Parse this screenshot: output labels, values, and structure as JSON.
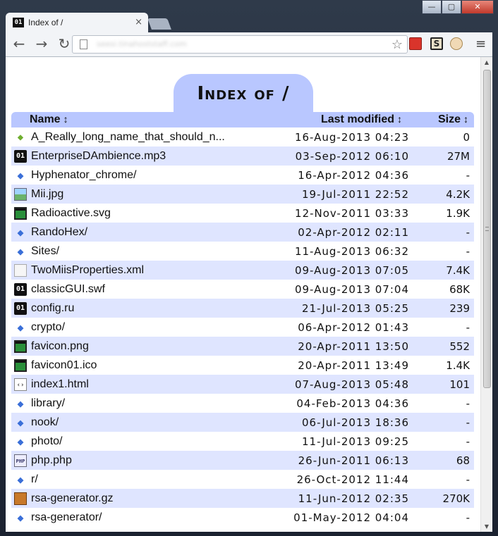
{
  "browser": {
    "tab_title": "Index of /",
    "tab_favicon_text": "01",
    "tab_close": "×",
    "url": "seesi.tinahoststaff.com",
    "window_buttons": [
      "—",
      "▢",
      "✕"
    ],
    "nav": {
      "back": "←",
      "forward": "→",
      "reload": "↻"
    },
    "star": "☆",
    "menu": "≡",
    "extension_s": "S"
  },
  "page": {
    "heading": "Index of /",
    "columns": {
      "name": "Name",
      "modified": "Last modified",
      "size": "Size",
      "sort_glyph": "↕"
    },
    "rows": [
      {
        "icon": "edge-icon",
        "name": "A_Really_long_name_that_should_n...",
        "modified": "16-Aug-2013 04:23",
        "size": "0"
      },
      {
        "icon": "binary-icon",
        "name": "EnterpriseDAmbience.mp3",
        "modified": "03-Sep-2012 06:10",
        "size": "27M"
      },
      {
        "icon": "folder-icon",
        "name": "Hyphenator_chrome/",
        "modified": "16-Apr-2012 04:36",
        "size": "-"
      },
      {
        "icon": "image-icon",
        "name": "Mii.jpg",
        "modified": "19-Jul-2011 22:52",
        "size": "4.2K"
      },
      {
        "icon": "svg-icon",
        "name": "Radioactive.svg",
        "modified": "12-Nov-2011 03:33",
        "size": "1.9K"
      },
      {
        "icon": "folder-icon",
        "name": "RandoHex/",
        "modified": "02-Apr-2012 02:11",
        "size": "-"
      },
      {
        "icon": "folder-icon",
        "name": "Sites/",
        "modified": "11-Aug-2013 06:32",
        "size": "-"
      },
      {
        "icon": "xml-icon",
        "name": "TwoMiisProperties.xml",
        "modified": "09-Aug-2013 07:05",
        "size": "7.4K"
      },
      {
        "icon": "binary-icon",
        "name": "classicGUI.swf",
        "modified": "09-Aug-2013 07:04",
        "size": "68K"
      },
      {
        "icon": "binary-icon",
        "name": "config.ru",
        "modified": "21-Jul-2013 05:25",
        "size": "239"
      },
      {
        "icon": "folder-icon",
        "name": "crypto/",
        "modified": "06-Apr-2012 01:43",
        "size": "-"
      },
      {
        "icon": "svg-icon",
        "name": "favicon.png",
        "modified": "20-Apr-2011 13:50",
        "size": "552"
      },
      {
        "icon": "svg-icon",
        "name": "favicon01.ico",
        "modified": "20-Apr-2011 13:49",
        "size": "1.4K"
      },
      {
        "icon": "html-icon",
        "name": "index1.html",
        "modified": "07-Aug-2013 05:48",
        "size": "101"
      },
      {
        "icon": "folder-icon",
        "name": "library/",
        "modified": "04-Feb-2013 04:36",
        "size": "-"
      },
      {
        "icon": "folder-icon",
        "name": "nook/",
        "modified": "06-Jul-2013 18:36",
        "size": "-"
      },
      {
        "icon": "folder-icon",
        "name": "photo/",
        "modified": "11-Jul-2013 09:25",
        "size": "-"
      },
      {
        "icon": "php-icon",
        "name": "php.php",
        "modified": "26-Jun-2011 06:13",
        "size": "68"
      },
      {
        "icon": "folder-icon",
        "name": "r/",
        "modified": "26-Oct-2012 11:44",
        "size": "-"
      },
      {
        "icon": "archive-icon",
        "name": "rsa-generator.gz",
        "modified": "11-Jun-2012 02:35",
        "size": "270K"
      },
      {
        "icon": "folder-icon",
        "name": "rsa-generator/",
        "modified": "01-May-2012 04:04",
        "size": "-"
      }
    ]
  },
  "colors": {
    "header_bg": "#b9c7ff",
    "row_alt_bg": "#dfe5ff"
  }
}
